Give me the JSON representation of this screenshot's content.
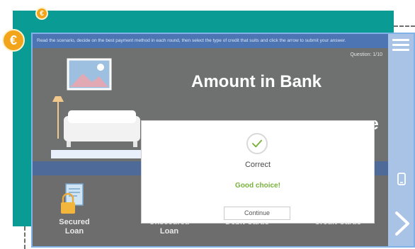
{
  "instruction": "Read the scenario, decide on the best payment method in each round, then select the type of credit that suits and click the arrow to submit your answer.",
  "question_counter": "Question: 1/10",
  "title_line1": "Amount in Bank",
  "title_line2_fragment": "se",
  "cards": [
    {
      "label_line1": "Secured",
      "label_line2": "Loan"
    },
    {
      "label_line1": "Unsecured",
      "label_line2": "Loan"
    },
    {
      "label_line1": "Debit Cards",
      "label_line2": ""
    },
    {
      "label_line1": "Credit Cards",
      "label_line2": ""
    }
  ],
  "modal": {
    "status": "Correct",
    "feedback": "Good choice!",
    "continue_label": "Continue"
  },
  "coin_symbol": "€",
  "colors": {
    "teal": "#0b9b95",
    "coin": "#f2a51a",
    "feedback_green": "#79b23c",
    "side_panel": "#a9c3e6"
  },
  "icons": [
    "hamburger-menu-icon",
    "phone-icon",
    "next-arrow-icon",
    "checkmark-icon",
    "coin-icon"
  ]
}
